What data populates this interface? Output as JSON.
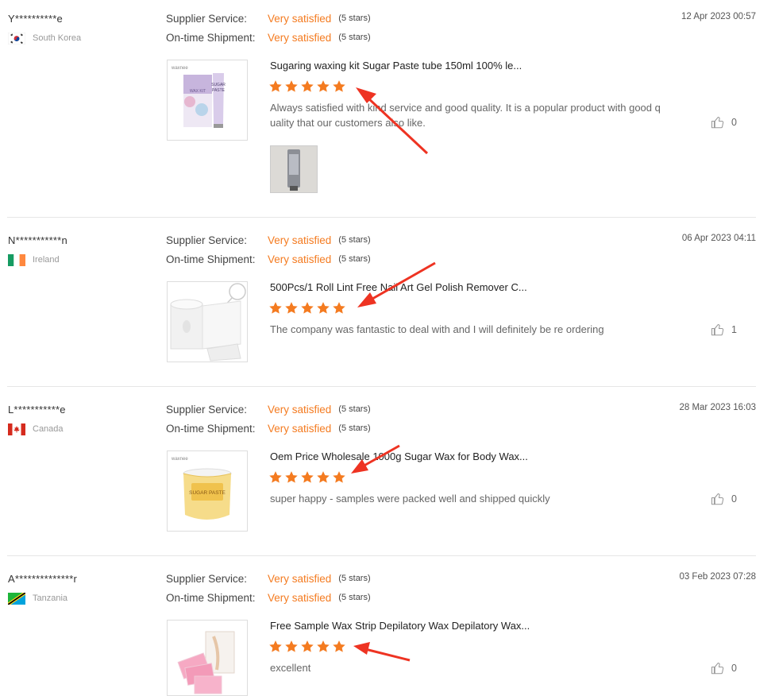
{
  "labels": {
    "supplier_service": "Supplier Service:",
    "ontime_shipment": "On-time Shipment:"
  },
  "accent_color": "#f47b20",
  "annotation_color": "#ee3322",
  "reviews": [
    {
      "name": "Y**********e",
      "country": "South Korea",
      "date": "12 Apr 2023 00:57",
      "supplier_value": "Very satisfied",
      "supplier_stars": "(5 stars)",
      "shipment_value": "Very satisfied",
      "shipment_stars": "(5 stars)",
      "product_title": "Sugaring waxing kit Sugar Paste tube 150ml 100% le...",
      "rating": 5,
      "comment": "Always satisfied with kind service and good quality. It is a popular product with good quality that our customers also like.",
      "likes": "0",
      "thumb_text": [
        "waxnee",
        "SUGAR",
        "PASTE",
        "WAX KIT"
      ]
    },
    {
      "name": "N***********n",
      "country": "Ireland",
      "date": "06 Apr 2023 04:11",
      "supplier_value": "Very satisfied",
      "supplier_stars": "(5 stars)",
      "shipment_value": "Very satisfied",
      "shipment_stars": "(5 stars)",
      "product_title": "500Pcs/1 Roll Lint Free Nail Art Gel Polish Remover C...",
      "rating": 5,
      "comment": "The company was fantastic to deal with and I will definitely be re ordering",
      "likes": "1"
    },
    {
      "name": "L***********e",
      "country": "Canada",
      "date": "28 Mar 2023 16:03",
      "supplier_value": "Very satisfied",
      "supplier_stars": "(5 stars)",
      "shipment_value": "Very satisfied",
      "shipment_stars": "(5 stars)",
      "product_title": "Oem Price Wholesale 1000g Sugar Wax for Body Wax...",
      "rating": 5,
      "comment": "super happy - samples were packed well and shipped quickly",
      "likes": "0",
      "thumb_text": [
        "waxnee",
        "SUGAR PASTE"
      ]
    },
    {
      "name": "A**************r",
      "country": "Tanzania",
      "date": "03 Feb 2023 07:28",
      "supplier_value": "Very satisfied",
      "supplier_stars": "(5 stars)",
      "shipment_value": "Very satisfied",
      "shipment_stars": "(5 stars)",
      "product_title": "Free Sample Wax Strip Depilatory Wax Depilatory Wax...",
      "rating": 5,
      "comment": "excellent",
      "likes": "0"
    }
  ]
}
